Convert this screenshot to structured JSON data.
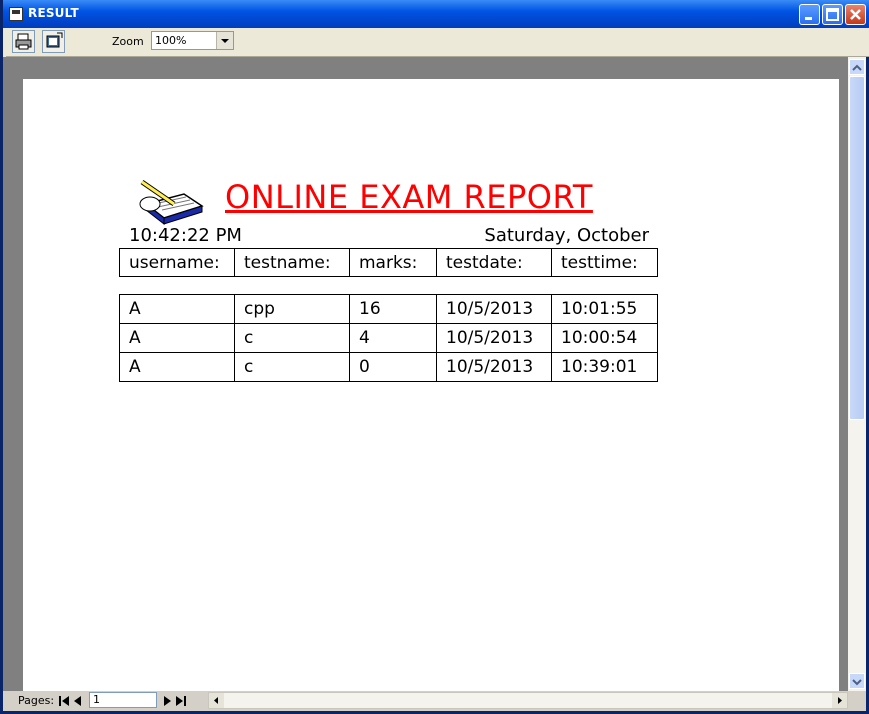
{
  "window": {
    "title": "RESULT"
  },
  "toolbar": {
    "zoom_label": "Zoom",
    "zoom_value": "100%"
  },
  "report": {
    "title": "ONLINE EXAM REPORT",
    "time": "10:42:22 PM",
    "date": "Saturday, October",
    "headers": [
      "username:",
      "testname:",
      "marks:",
      "testdate:",
      "testtime:"
    ],
    "rows": [
      [
        "A",
        "cpp",
        "16",
        "10/5/2013",
        "10:01:55"
      ],
      [
        "A",
        "c",
        "4",
        "10/5/2013",
        "10:00:54"
      ],
      [
        "A",
        "c",
        "0",
        "10/5/2013",
        "10:39:01"
      ]
    ]
  },
  "status": {
    "pages_label": "Pages:",
    "page_number": "1"
  },
  "colors": {
    "title_red": "#ff0000",
    "titlebar_blue": "#0054e3"
  }
}
